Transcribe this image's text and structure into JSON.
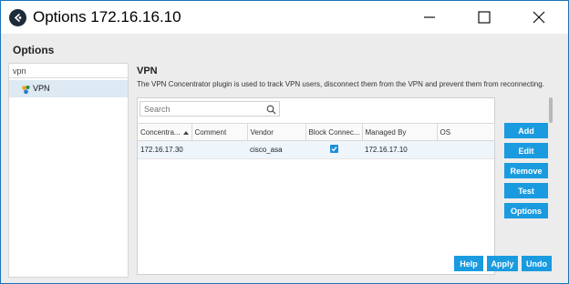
{
  "window": {
    "title": "Options 172.16.16.10"
  },
  "options": {
    "header": "Options",
    "filter_value": "vpn",
    "tree": [
      {
        "label": "VPN",
        "icon": "vpn-plugin-icon"
      }
    ]
  },
  "vpn": {
    "title": "VPN",
    "description": "The VPN Concentrator plugin is used to track VPN users, disconnect them from the VPN and prevent them from reconnecting.",
    "search_placeholder": "Search",
    "columns": [
      "Concentra...",
      "Comment",
      "Vendor",
      "Block Connec...",
      "Managed By",
      "OS"
    ],
    "rows": [
      {
        "concentrator": "172.16.17.30",
        "comment": "",
        "vendor": "cisco_asa",
        "block_connections": true,
        "managed_by": "172.16.17.10",
        "os": ""
      }
    ]
  },
  "side_buttons": {
    "add": "Add",
    "edit": "Edit",
    "remove": "Remove",
    "test": "Test",
    "options": "Options"
  },
  "bottom_buttons": {
    "help": "Help",
    "apply": "Apply",
    "undo": "Undo"
  },
  "colors": {
    "accent": "#1a9be0",
    "selection": "#dde9f3",
    "window_border": "#1a73b8"
  }
}
